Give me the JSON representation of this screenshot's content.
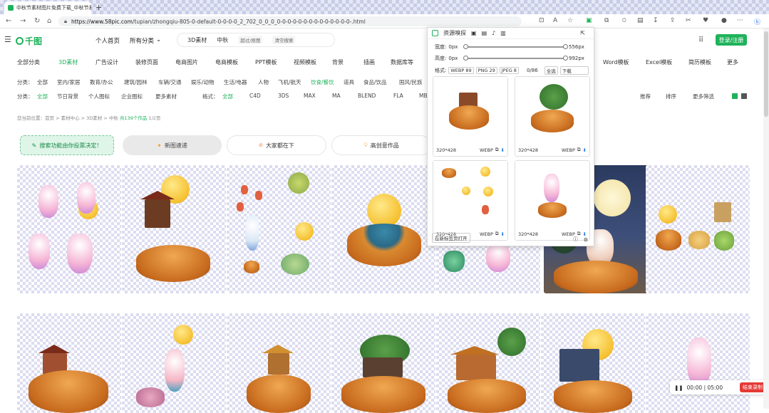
{
  "browser": {
    "tab_title": "中秋节素材图片免费下载_中秋节素材",
    "url_host": "https://www.58pic.com",
    "url_path": "/tupian/zhongqiu-805-0-default-0-0-0-0_2_702_0_0_0_0-0-0-0-0-0-0-0-0-0-0-0-0-0-.html"
  },
  "header": {
    "logo": "千图",
    "nav": [
      "个人首页",
      "所有分类"
    ],
    "search_type": "3D素材",
    "search_query": "中秋",
    "search_tags": [
      "超过/抠图",
      "清空搜索"
    ],
    "login": "登录/注册"
  },
  "categories": [
    "全部分类",
    "3D素材",
    "广告设计",
    "装修页面",
    "电商图片",
    "电商模板",
    "PPT模板",
    "视频模板",
    "背景",
    "插画",
    "数据库等",
    "Word模板",
    "Excel模板",
    "简历模板",
    "更多"
  ],
  "filter_row": [
    "分类：",
    "全部",
    "室内/家居",
    "教育/办公",
    "建筑/园林",
    "车辆/交通",
    "娱乐/动物",
    "生活/电器",
    "人物",
    "飞机/航天",
    "饮食/餐饮",
    "道具",
    "食品/饮品",
    "国风/民族"
  ],
  "filter_row2": [
    "分类：",
    "全部",
    "节日背景",
    "个人图标",
    "企业图标",
    "更多素材",
    "格式：",
    "全部",
    "C4D",
    "3DS",
    "MAX",
    "MA",
    "BLEND",
    "FLA",
    "MB"
  ],
  "sort_bar": [
    "推荐",
    "排序",
    "更多筛选"
  ],
  "breadcrumb": {
    "prefix": "您当前位置：首页 > 素材中心 > 3D素材 > 中秋",
    "count": "共139个作品",
    "pages": "1/2页"
  },
  "banners": [
    "搜索功能由你投票决定！",
    "新图速递",
    "大家都在下",
    "高创意作品"
  ],
  "panel": {
    "title": "资源嗅探",
    "width_label": "宽度:",
    "width_min": "0px",
    "width_max": "556px",
    "height_label": "高度:",
    "height_min": "0px",
    "height_max": "992px",
    "width_fraction": 1.0,
    "height_fraction": 1.0,
    "format_label": "格式:",
    "formats": [
      "WEBP 89",
      "PNG 29",
      "JPEG 8"
    ],
    "count": "0/86",
    "select_all": "全选",
    "download": "下载",
    "items": [
      {
        "size": "320*428",
        "format": "WEBP"
      },
      {
        "size": "320*428",
        "format": "WEBP"
      },
      {
        "size": "320*428",
        "format": "WEBP"
      },
      {
        "size": "320*428",
        "format": "WEBP"
      }
    ],
    "open_new_tab": "在新标签页打开"
  },
  "recorder": {
    "time": "00:00 | 05:00",
    "stop": "结束录制"
  },
  "colors": {
    "brand": "#1fb25a",
    "record": "#e53935"
  }
}
